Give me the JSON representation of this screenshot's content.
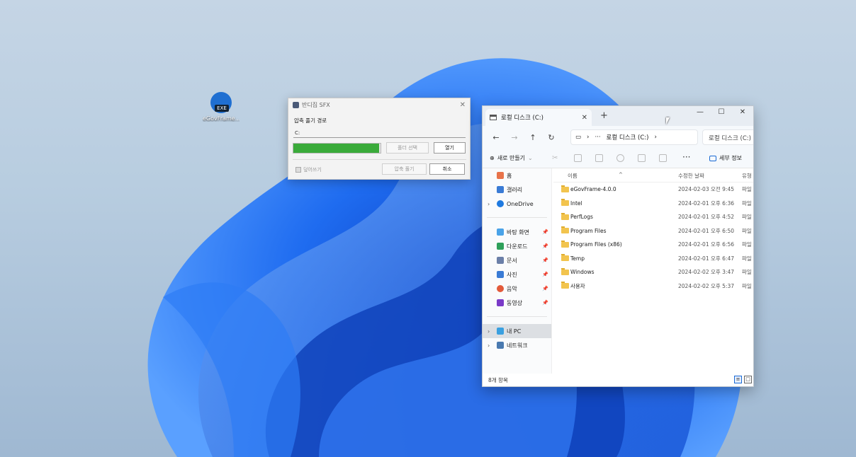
{
  "desktop": {
    "icon_label": "eGovFrame...",
    "icon_badge": "EXE"
  },
  "sfx": {
    "title": "반디집 SFX",
    "extract_path_label": "압축 풀기 경로",
    "path_value": "C:",
    "progress": 0.98,
    "folder_select_button": "폴더 선택",
    "open_button": "열기",
    "overwrite_label": "덮어쓰기",
    "extract_button": "압축 풀기",
    "cancel_button": "취소"
  },
  "explorer": {
    "tab_title": "로컬 디스크 (C:)",
    "new_tab": "+",
    "window_controls": {
      "minimize": "—",
      "maximize": "☐",
      "close": "✕"
    },
    "breadcrumb": {
      "more": "···",
      "current": "로컬 디스크 (C:)"
    },
    "search_placeholder": "로컬 디스크 (C:) 검색",
    "toolbar": {
      "new_label": "새로 만들기",
      "more": "···",
      "details_label": "세부 정보"
    },
    "nav": {
      "home": "홈",
      "gallery": "갤러리",
      "onedrive": "OneDrive",
      "desktop": "바탕 화면",
      "downloads": "다운로드",
      "documents": "문서",
      "pictures": "사진",
      "music": "음악",
      "videos": "동영상",
      "this_pc": "내 PC",
      "network": "네트워크"
    },
    "columns": {
      "name": "이름",
      "modified": "수정한 날짜",
      "type": "유형"
    },
    "rows": [
      {
        "name": "eGovFrame-4.0.0",
        "date": "2024-02-03 오전 9:45",
        "type": "파일"
      },
      {
        "name": "Intel",
        "date": "2024-02-01 오후 6:36",
        "type": "파일"
      },
      {
        "name": "PerfLogs",
        "date": "2024-02-01 오후 4:52",
        "type": "파일"
      },
      {
        "name": "Program Files",
        "date": "2024-02-01 오후 6:50",
        "type": "파일"
      },
      {
        "name": "Program Files (x86)",
        "date": "2024-02-01 오후 6:56",
        "type": "파일"
      },
      {
        "name": "Temp",
        "date": "2024-02-01 오후 6:47",
        "type": "파일"
      },
      {
        "name": "Windows",
        "date": "2024-02-02 오후 3:47",
        "type": "파일"
      },
      {
        "name": "사용자",
        "date": "2024-02-02 오후 5:37",
        "type": "파일"
      }
    ],
    "status_count": "8개 항목"
  },
  "colors": {
    "accent": "#1a6ad4",
    "progress": "#3aab3a",
    "folder": "#f2c44e"
  }
}
